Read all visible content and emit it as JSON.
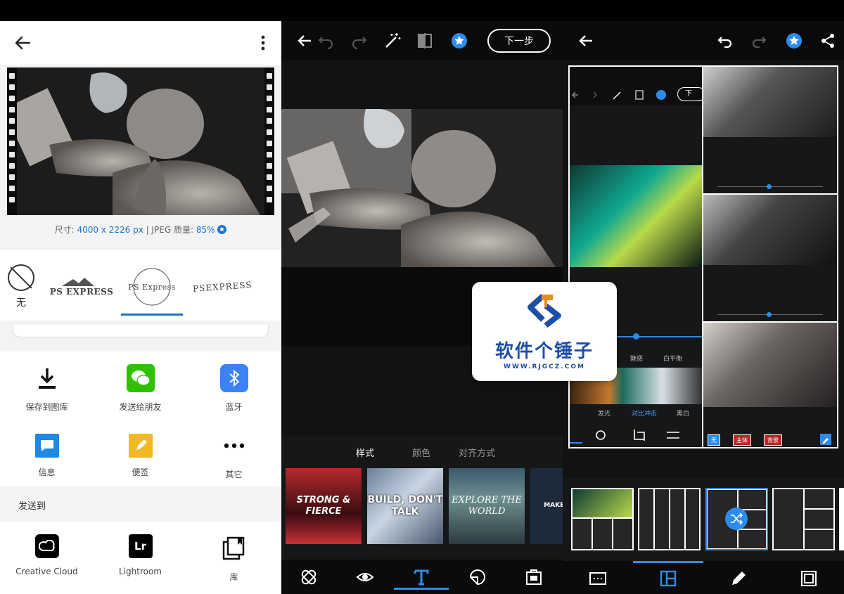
{
  "panel1": {
    "meta": {
      "prefix": "尺寸: ",
      "size": "4000 x 2226 px",
      "sep": " | JPEG 质量: ",
      "quality": "85%"
    },
    "watermarks": [
      {
        "label": "无"
      },
      {
        "label": "PS EXPRESS"
      },
      {
        "label": "PS Express"
      },
      {
        "label": "PSEXPRESS"
      }
    ],
    "share": [
      {
        "label": "保存到图库",
        "icon": "download-icon",
        "color": "#ffffff"
      },
      {
        "label": "发送给朋友",
        "icon": "wechat-icon",
        "color": "#2dc100"
      },
      {
        "label": "蓝牙",
        "icon": "bluetooth-icon",
        "color": "#3b82f6"
      },
      {
        "label": "信息",
        "icon": "message-icon",
        "color": "#1e88e5"
      },
      {
        "label": "便签",
        "icon": "note-icon",
        "color": "#f2b824"
      },
      {
        "label": "其它",
        "icon": "more-icon",
        "color": "#ffffff"
      }
    ],
    "sendto_label": "发送到",
    "apps": [
      {
        "label": "Creative Cloud",
        "icon": "creative-cloud-icon"
      },
      {
        "label": "Lightroom",
        "icon": "lightroom-icon",
        "glyph": "Lr"
      },
      {
        "label": "库",
        "icon": "library-icon"
      }
    ]
  },
  "panel2": {
    "next_label": "下一步",
    "tabs": [
      "样式",
      "颜色",
      "对齐方式"
    ],
    "templates": [
      {
        "text": "STRONG & FIERCE"
      },
      {
        "text": "BUILD, DON'T TALK"
      },
      {
        "text": "EXPLORE THE WORLD"
      },
      {
        "text": "MAKE IT SIGN"
      }
    ]
  },
  "logo": {
    "cn": "软件个锤子",
    "url": "WWW.RJGCZ.COM"
  },
  "panel3": {
    "mini_next": "下",
    "filter_labels": [
      "魅惑",
      "白平衡"
    ],
    "filter_names": [
      "发光",
      "对比冲击",
      "黑白"
    ],
    "chips": [
      "无",
      "主体",
      "背景"
    ]
  },
  "colors": {
    "accent": "#2d8ceb",
    "link_blue": "#1a73c9",
    "brand_blue": "#1d4ea8"
  }
}
